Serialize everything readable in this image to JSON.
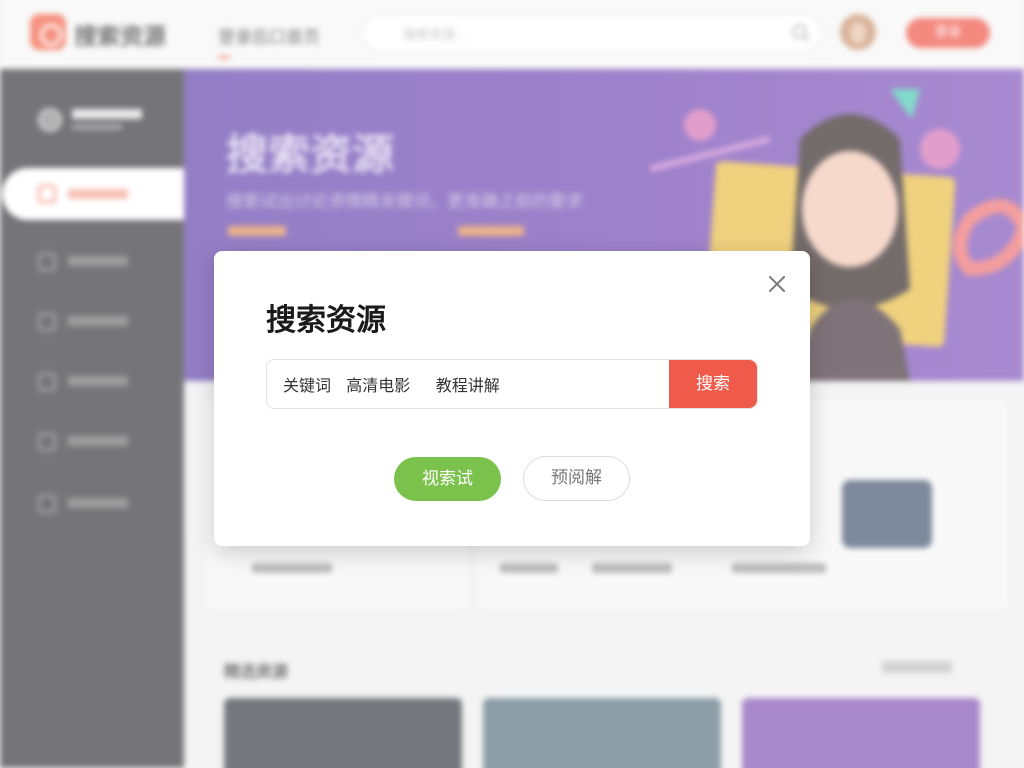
{
  "header": {
    "logo_text": "搜索资源",
    "nav_home": "登录后口首页",
    "search_placeholder": "搜索资源…",
    "login_label": "登录"
  },
  "banner": {
    "title": "搜索资源",
    "subtitle": "搜索试出讨论添情精关键词，更准确之前的要求"
  },
  "section": {
    "title": "精选资源"
  },
  "modal": {
    "title": "搜索资源",
    "search_value": "关键词   高清电影     教程讲解",
    "search_button": "搜索",
    "primary_button": "视索试",
    "secondary_button": "预阅解"
  },
  "colors": {
    "accent": "#ef5a4b",
    "primary_green": "#7bc24d",
    "banner_purple": "#6b3fb0",
    "sidebar_dark": "#2c2c30"
  }
}
